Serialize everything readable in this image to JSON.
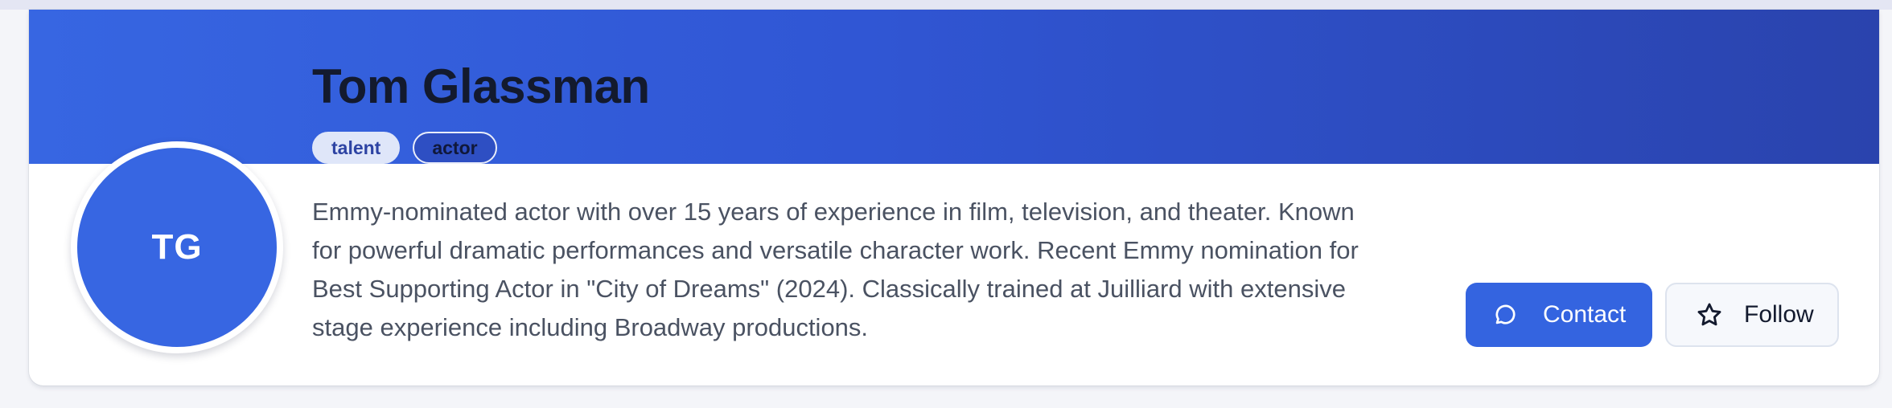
{
  "profile": {
    "name": "Tom Glassman",
    "initials": "TG",
    "tags": [
      "talent",
      "actor"
    ],
    "bio": "Emmy-nominated actor with over 15 years of experience in film, television, and theater. Known for powerful dramatic performances and versatile character work. Recent Emmy nomination for Best Supporting Actor in \"City of Dreams\" (2024). Classically trained at Juilliard with extensive stage experience including Broadway productions."
  },
  "actions": {
    "contact_label": "Contact",
    "contact_icon": "chat-bubble-icon",
    "follow_label": "Follow",
    "follow_icon": "star-outline-icon"
  },
  "colors": {
    "accent": "#3464e0",
    "banner_start": "#3766e2",
    "banner_end": "#2a43ad",
    "name_text": "#131a2e",
    "body_text": "#4a5262"
  }
}
